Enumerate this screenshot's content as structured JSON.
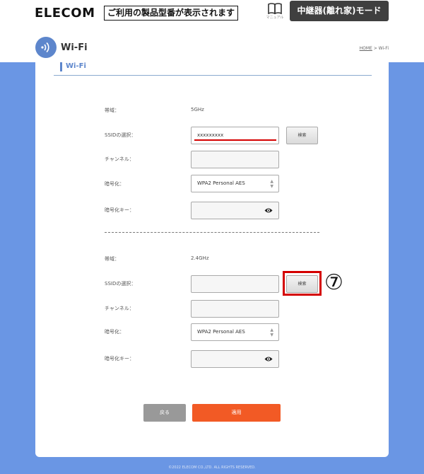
{
  "header": {
    "logo": "ELECOM",
    "model_notice": "ご利用の製品型番が表示されます",
    "manual_label": "マニュアル",
    "mode_button": "中継器(離れ家)モード"
  },
  "page": {
    "title": "Wi-Fi",
    "breadcrumb_home": "HOME",
    "breadcrumb_sep": " > ",
    "breadcrumb_current": "Wi-Fi",
    "section_title": "Wi-Fi"
  },
  "band5": {
    "band_label": "帯域：",
    "band_value": "5GHz",
    "ssid_label": "SSIDの選択：",
    "ssid_value": "xxxxxxxxx",
    "search_button": "検索",
    "channel_label": "チャンネル：",
    "channel_value": "",
    "encryption_label": "暗号化：",
    "encryption_value": "WPA2 Personal AES",
    "key_label": "暗号化キー：",
    "key_value": ""
  },
  "band24": {
    "band_label": "帯域：",
    "band_value": "2.4GHz",
    "ssid_label": "SSIDの選択：",
    "ssid_value": "",
    "search_button": "検索",
    "channel_label": "チャンネル：",
    "channel_value": "",
    "encryption_label": "暗号化：",
    "encryption_value": "WPA2 Personal AES",
    "key_label": "暗号化キー：",
    "key_value": ""
  },
  "annotation": {
    "step_marker": "⑦",
    "highlight_color": "#d40000"
  },
  "actions": {
    "back_label": "戻る",
    "apply_label": "適用"
  },
  "footer": {
    "copyright": "©2022 ELECOM CO.,LTD. ALL RIGHTS RESERVED."
  },
  "colors": {
    "background": "#6a96e4",
    "accent": "#5d86cc",
    "apply": "#f25a25",
    "mode_button": "#3f3f3f"
  }
}
